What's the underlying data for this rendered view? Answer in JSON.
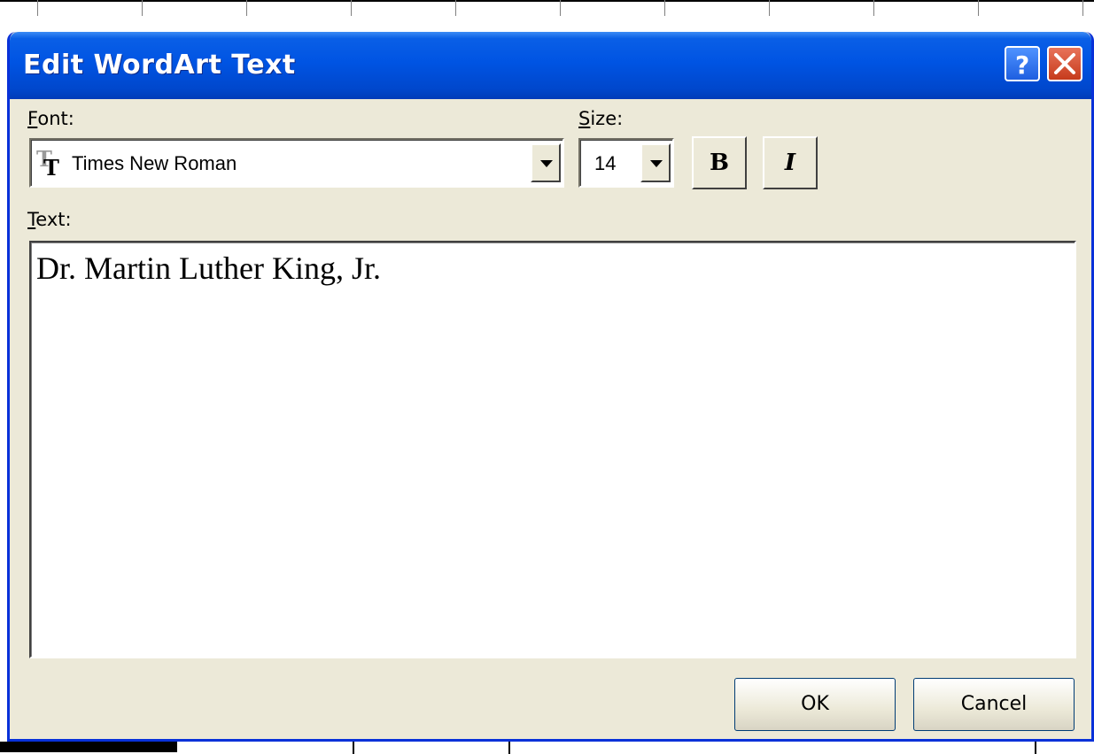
{
  "dialog": {
    "title": "Edit WordArt Text",
    "help_button": "?",
    "font": {
      "label": "Font:",
      "label_mnemonic": "F",
      "label_rest": "ont:",
      "value": "Times New Roman"
    },
    "size": {
      "label_mnemonic": "S",
      "label_rest": "ize:",
      "value": "14"
    },
    "bold_label": "B",
    "italic_label": "I",
    "text": {
      "label_mnemonic": "T",
      "label_rest": "ext:",
      "value": "Dr. Martin Luther King, Jr."
    },
    "ok_label": "OK",
    "cancel_label": "Cancel"
  },
  "colors": {
    "titlebar": "#0054e3",
    "dialog_face": "#ece9d8",
    "close_button": "#c63b1c"
  },
  "icons": {
    "font_type": "truetype-icon",
    "dropdown": "chevron-down-icon",
    "close": "close-icon",
    "help": "help-icon"
  }
}
